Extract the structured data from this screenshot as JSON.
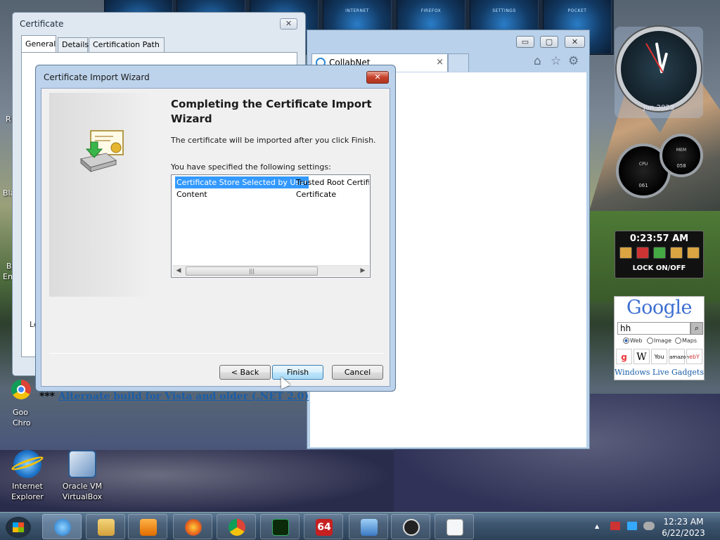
{
  "desktop": {
    "icons": [
      {
        "label": "Internet Explorer"
      },
      {
        "label": "Oracle VM VirtualBox"
      }
    ],
    "partial_icons": {
      "google_chrome": "Goo\nChro",
      "left_r": "R",
      "left_bla": "Bla",
      "left_b": "B",
      "left_en": "En"
    },
    "gadget_tiles": [
      "",
      "",
      "",
      "INTERNET",
      "FIREFOX",
      "SETTINGS",
      "POCKET"
    ]
  },
  "browser": {
    "tab_title": "CollabNet",
    "controls": {
      "minimize": "▭",
      "maximize": "▢",
      "close": "✕"
    },
    "link_prefix": "***",
    "link_text": "Alternate build for Vista and older (.NET 2.0)"
  },
  "certificate_dialog": {
    "title": "Certificate",
    "close": "✕",
    "tabs": [
      "General",
      "Details",
      "Certification Path"
    ],
    "left_label": "Le"
  },
  "wizard": {
    "title": "Certificate Import Wizard",
    "close": "✕",
    "heading": "Completing the Certificate Import Wizard",
    "intro": "The certificate will be imported after you click Finish.",
    "settings_label": "You have specified the following settings:",
    "settings": [
      {
        "name": "Certificate Store Selected by User",
        "value": "Trusted Root Certification Authorities"
      },
      {
        "name": "Content",
        "value": "Certificate"
      }
    ],
    "scroll": {
      "left": "◀",
      "right": "▶",
      "grip": "|||"
    },
    "buttons": {
      "back": "< Back",
      "finish": "Finish",
      "cancel": "Cancel"
    }
  },
  "gadgets": {
    "clock_label": "Jun 2023",
    "timer": "0:23:57 AM",
    "lock": "LOCK ON/OFF",
    "gauges": [
      {
        "label": "CPU",
        "value": "061"
      },
      {
        "label": "MEM",
        "value": "058"
      }
    ],
    "google": {
      "logo": "Google",
      "search_value": "hh",
      "options": [
        "Web",
        "Image",
        "Maps"
      ],
      "selected": "Web",
      "icons": [
        "W",
        "You",
        "amazon",
        "ebY"
      ],
      "footer": "Windows Live Gadgets"
    }
  },
  "taskbar": {
    "time": "12:23 AM",
    "date": "6/22/2023",
    "pinned": [
      "internet-explorer",
      "file-explorer",
      "media-player",
      "firefox",
      "chrome",
      "terminal",
      "64bit-app",
      "network-app",
      "cursor-app",
      "document"
    ],
    "badge_64": "64",
    "tray_up": "▲"
  }
}
